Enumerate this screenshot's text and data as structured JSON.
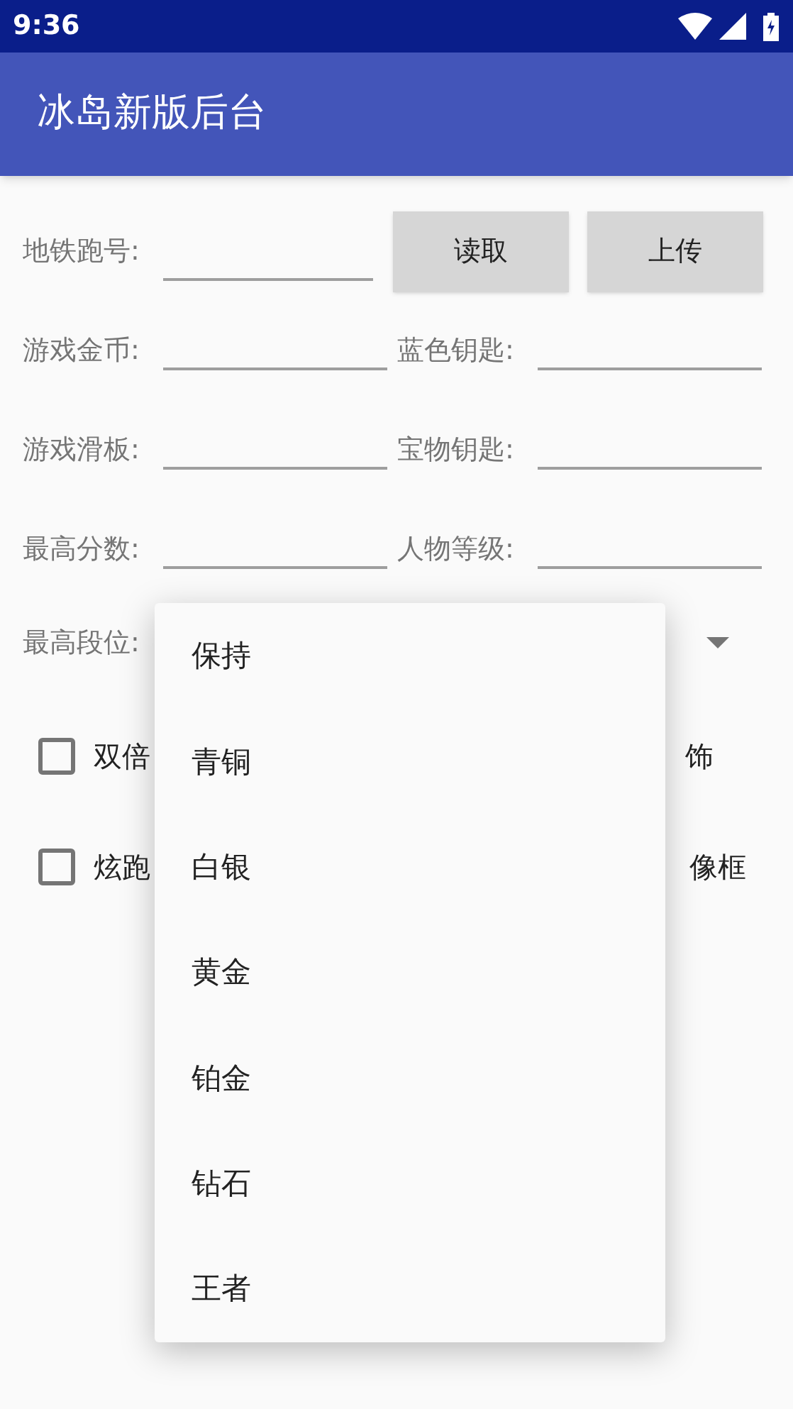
{
  "status_bar": {
    "time": "9:36"
  },
  "app_bar": {
    "title": "冰岛新版后台"
  },
  "subway_field": {
    "label": "地铁跑号:"
  },
  "buttons": [
    "读取",
    "上传"
  ],
  "field_rows": [
    {
      "left_label": "游戏金币:",
      "right_label": "蓝色钥匙:"
    },
    {
      "left_label": "游戏滑板:",
      "right_label": "宝物钥匙:"
    },
    {
      "left_label": "最高分数:",
      "right_label": "人物等级:"
    }
  ],
  "rank_spinner": {
    "label": "最高段位:"
  },
  "checkbox_rows": [
    {
      "label": "双倍",
      "checked": false,
      "right_text": "饰"
    },
    {
      "label": "炫跑",
      "checked": false,
      "right_text": "像框"
    }
  ],
  "dropdown_menu": {
    "items": [
      "保持",
      "青铜",
      "白银",
      "黄金",
      "铂金",
      "钻石",
      "王者"
    ]
  }
}
